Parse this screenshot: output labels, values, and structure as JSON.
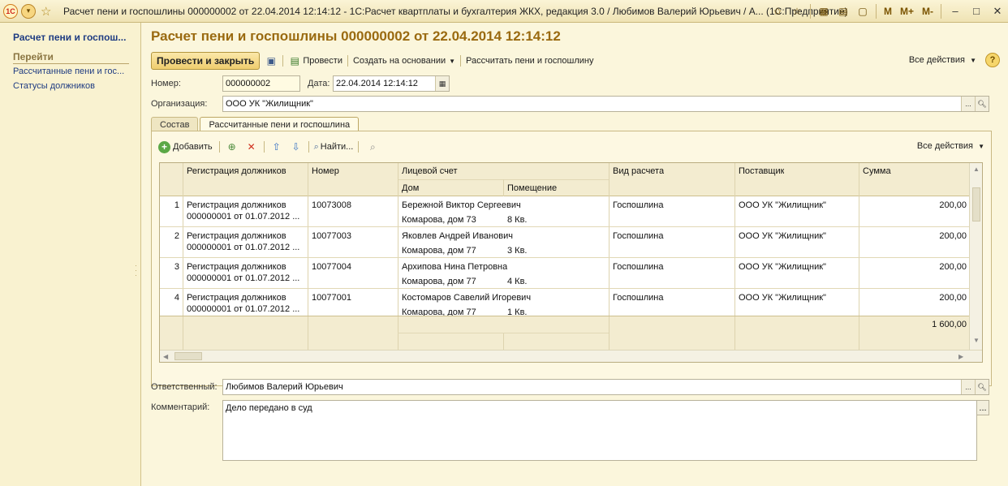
{
  "window": {
    "title": "Расчет пени и госпошлины 000000002 от 22.04.2014 12:14:12 - 1С:Расчет квартплаты и бухгалтерия ЖКХ, редакция 3.0 / Любимов Валерий Юрьевич / А...  (1С:Предприятие)",
    "logo_text": "1С",
    "mm": [
      "M",
      "M+",
      "M-"
    ]
  },
  "sidebar": {
    "title": "Расчет пени и госпош...",
    "section": "Перейти",
    "links": [
      "Рассчитанные пени и гос...",
      "Статусы должников"
    ]
  },
  "doc": {
    "title": "Расчет пени и госпошлины 000000002 от 22.04.2014 12:14:12"
  },
  "toolbar": {
    "post_close": "Провести и закрыть",
    "post": "Провести",
    "create_based": "Создать на основании",
    "calc": "Рассчитать пени и госпошлину",
    "all_actions": "Все действия",
    "help": "?"
  },
  "form": {
    "number_label": "Номер:",
    "number_value": "000000002",
    "date_label": "Дата:",
    "date_value": "22.04.2014 12:14:12",
    "org_label": "Организация:",
    "org_value": "ООО УК \"Жилищник\"",
    "resp_label": "Ответственный:",
    "resp_value": "Любимов Валерий Юрьевич",
    "comment_label": "Комментарий:",
    "comment_value": "Дело передано в суд"
  },
  "tabs": [
    "Состав",
    "Рассчитанные пени и госпошлина"
  ],
  "table_toolbar": {
    "add": "Добавить",
    "find": "Найти...",
    "all_actions": "Все действия"
  },
  "table": {
    "headers": {
      "registration": "Регистрация должников",
      "number": "Номер",
      "account": "Лицевой счет",
      "house": "Дом",
      "premises": "Помещение",
      "calc_type": "Вид расчета",
      "supplier": "Поставщик",
      "sum": "Сумма"
    },
    "rows": [
      {
        "n": "1",
        "reg1": "Регистрация должников",
        "reg2": "000000001 от 01.07.2012 ...",
        "number": "10073008",
        "account": "Бережной Виктор Сергеевич",
        "house": "Комарова, дом 73",
        "premises": "8 Кв.",
        "calc_type": "Госпошлина",
        "supplier": "ООО УК \"Жилищник\"",
        "sum": "200,00"
      },
      {
        "n": "2",
        "reg1": "Регистрация должников",
        "reg2": "000000001 от 01.07.2012 ...",
        "number": "10077003",
        "account": "Яковлев Андрей Иванович",
        "house": "Комарова, дом 77",
        "premises": "3 Кв.",
        "calc_type": "Госпошлина",
        "supplier": "ООО УК \"Жилищник\"",
        "sum": "200,00"
      },
      {
        "n": "3",
        "reg1": "Регистрация должников",
        "reg2": "000000001 от 01.07.2012 ...",
        "number": "10077004",
        "account": "Архипова Нина Петровна",
        "house": "Комарова, дом 77",
        "premises": "4 Кв.",
        "calc_type": "Госпошлина",
        "supplier": "ООО УК \"Жилищник\"",
        "sum": "200,00"
      },
      {
        "n": "4",
        "reg1": "Регистрация должников",
        "reg2": "000000001 от 01.07.2012 ...",
        "number": "10077001",
        "account": "Костомаров Савелий Игоревич",
        "house": "Комарова, дом 77",
        "premises": "1 Кв.",
        "calc_type": "Госпошлина",
        "supplier": "ООО УК \"Жилищник\"",
        "sum": "200,00"
      }
    ],
    "total": "1 600,00"
  }
}
